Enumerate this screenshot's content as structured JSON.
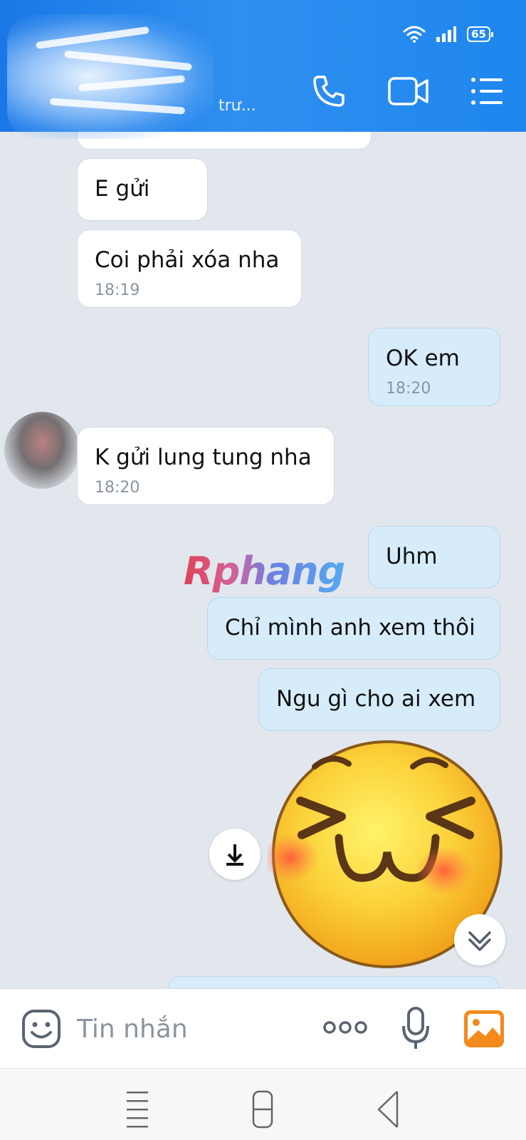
{
  "header": {
    "subtitle": "trư...",
    "battery": "65"
  },
  "messages": [
    {
      "id": "m1",
      "direction": "incoming",
      "text": "E gửi",
      "time": ""
    },
    {
      "id": "m2",
      "direction": "incoming",
      "text": "Coi phải xóa nha",
      "time": "18:19"
    },
    {
      "id": "m3",
      "direction": "outgoing",
      "text": "OK em",
      "time": "18:20"
    },
    {
      "id": "m4",
      "direction": "incoming",
      "text": "K gửi lung tung nha",
      "time": "18:20"
    },
    {
      "id": "m5",
      "direction": "outgoing",
      "text": "Uhm",
      "time": ""
    },
    {
      "id": "m6",
      "direction": "outgoing",
      "text": "Chỉ mình anh xem thôi",
      "time": ""
    },
    {
      "id": "m7",
      "direction": "outgoing",
      "text": "Ngu gì cho ai xem",
      "time": ""
    }
  ],
  "watermark": "Rphang",
  "input": {
    "placeholder": "Tin nhắn"
  },
  "icons": {
    "header": [
      "phone-icon",
      "video-call-icon",
      "menu-list-icon"
    ],
    "input": [
      "emoji-icon",
      "more-options-icon",
      "microphone-icon",
      "image-gallery-icon"
    ],
    "nav": [
      "recent-apps-icon",
      "home-icon",
      "back-icon"
    ]
  },
  "colors": {
    "header_blue": "#1a78e6",
    "chat_background": "#e2e7ee",
    "outgoing_bubble": "#d6ecfb",
    "incoming_bubble": "#ffffff",
    "gallery_icon": "#f28a1c"
  }
}
